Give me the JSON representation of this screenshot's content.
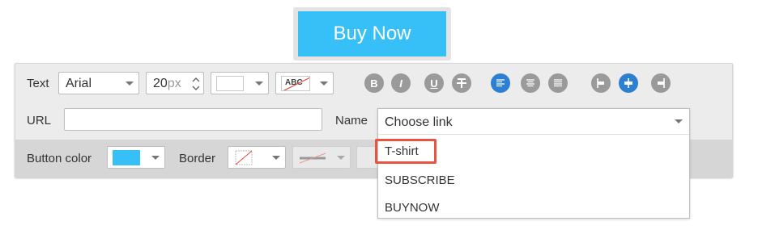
{
  "preview": {
    "button_label": "Buy Now",
    "button_color": "#37bff8"
  },
  "toolbar": {
    "text_label": "Text",
    "font_family": "Arial",
    "font_size": "20",
    "font_size_unit": "px",
    "strike_swatch_text": "ABC",
    "url_label": "URL",
    "url_value": "",
    "name_label": "Name",
    "button_color_label": "Button color",
    "border_label": "Border",
    "format_buttons": [
      "B",
      "I",
      "U",
      "T"
    ]
  },
  "link_dropdown": {
    "selected": "Choose link",
    "options": [
      "T-shirt",
      "SUBSCRIBE",
      "BUYNOW"
    ]
  },
  "colors": {
    "accent": "#2d7fd3",
    "highlight": "#e8553f"
  }
}
